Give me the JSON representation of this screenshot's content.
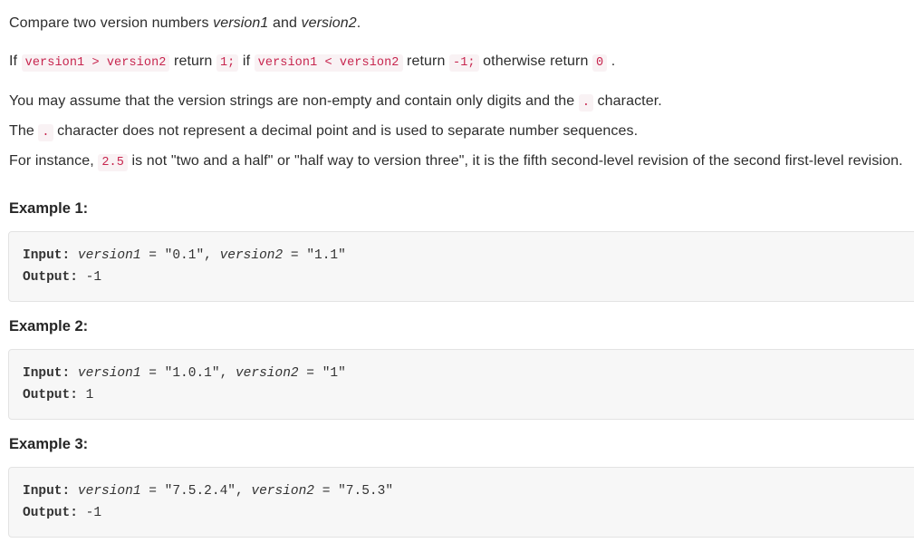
{
  "problem": {
    "intro_paragraph": {
      "line1": {
        "pre": "Compare two version numbers ",
        "var1": "version1",
        "mid": " and ",
        "var2": "version2",
        "post": "."
      },
      "line2": {
        "t1": "If ",
        "c1": "version1 > version2",
        "t2": " return ",
        "c2": "1;",
        "t3": " if ",
        "c3": "version1 < version2",
        "t4": " return ",
        "c4": "-1;",
        "t5": " otherwise return ",
        "c5": "0",
        "t6": " ."
      }
    },
    "body_paragraph": {
      "line1": {
        "t1": "You may assume that the version strings are non-empty and contain only digits and the ",
        "c1": ".",
        "t2": " character."
      },
      "line2": {
        "t1": "The ",
        "c1": ".",
        "t2": " character does not represent a decimal point and is used to separate number sequences."
      },
      "line3": {
        "t1": "For instance, ",
        "c1": "2.5",
        "t2": " is not \"two and a half\" or \"half way to version three\", it is the fifth second-level revision of the second first-level revision."
      }
    }
  },
  "examples": [
    {
      "heading": "Example 1:",
      "input_label": "Input:",
      "input_var1": "version1",
      "input_eq1": " = ",
      "input_val1": "\"0.1\",",
      "input_var2": "version2",
      "input_eq2": " = ",
      "input_val2": "\"1.1\"",
      "output_label": "Output:",
      "output_value": "-1"
    },
    {
      "heading": "Example 2:",
      "input_label": "Input:",
      "input_var1": "version1",
      "input_eq1": " = ",
      "input_val1": "\"1.0.1\",",
      "input_var2": "version2",
      "input_eq2": " = ",
      "input_val2": "\"1\"",
      "output_label": "Output:",
      "output_value": "1"
    },
    {
      "heading": "Example 3:",
      "input_label": "Input:",
      "input_var1": "version1",
      "input_eq1": " = ",
      "input_val1": "\"7.5.2.4\",",
      "input_var2": "version2",
      "input_eq2": " = ",
      "input_val2": "\"7.5.3\"",
      "output_label": "Output:",
      "output_value": "-1"
    }
  ],
  "colors": {
    "inline_code_text": "#c7254e",
    "inline_code_bg": "#f9f2f4",
    "code_block_bg": "#f7f7f7",
    "code_block_border": "#e3e3e3",
    "body_text": "#2d2d2d"
  }
}
